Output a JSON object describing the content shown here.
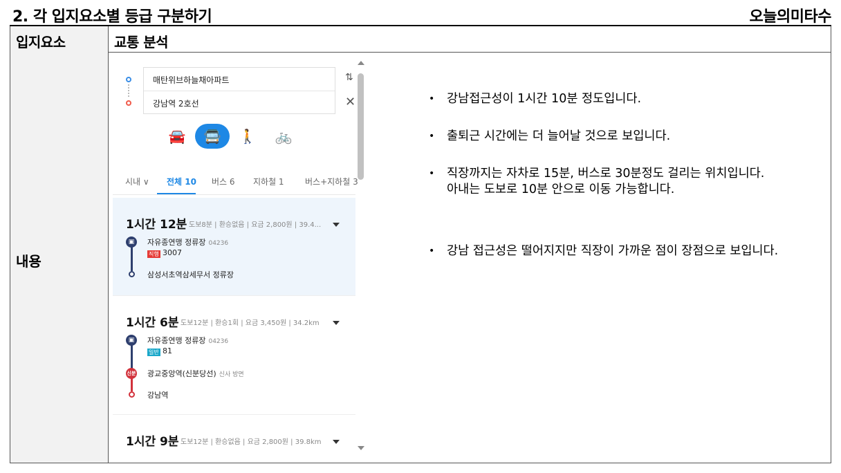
{
  "header": {
    "title": "2. 각 입지요소별 등급 구분하기",
    "brand": "오늘의미타수"
  },
  "table": {
    "label_1": "입지요소",
    "heading": "교통 분석",
    "label_2": "내용"
  },
  "app": {
    "origin": "매탄위브하늘채아파트",
    "destination": "강남역 2호선",
    "swap_icon": "⇅",
    "close_icon": "✕",
    "modes": [
      {
        "name": "car",
        "glyph": "🚘"
      },
      {
        "name": "transit",
        "glyph": "🚍"
      },
      {
        "name": "walk",
        "glyph": "🚶"
      },
      {
        "name": "bike",
        "glyph": "🚲"
      }
    ],
    "tabs": [
      "시내 ∨",
      "전체 10",
      "버스 6",
      "지하철 1",
      "버스+지하철 3"
    ],
    "routes": [
      {
        "time": "1시간 12분",
        "meta": "도보8분 | 환승없음 | 요금 2,800원 | 39.4...",
        "stop1": "자유종연맹 정류장",
        "stop1_code": "04236",
        "badge": "직행",
        "bus": "3007",
        "end": "삼성서초역삼세무서 정류장"
      },
      {
        "time": "1시간 6분",
        "meta": "도보12분 | 환승1회 | 요금 3,450원 | 34.2km",
        "stop1": "자유종연맹 정류장",
        "stop1_code": "04236",
        "badge": "일반",
        "bus": "81",
        "transfer_badge": "신분",
        "transfer": "광교중앙역(신분당선)",
        "transfer_dir": "신사 방면",
        "end": "강남역"
      },
      {
        "time": "1시간 9분",
        "meta": "도보12분 | 환승없음 | 요금 2,800원 | 39.8km"
      }
    ]
  },
  "bullets": [
    "강남접근성이 1시간 10분 정도입니다.",
    "출퇴근 시간에는 더 늘어날 것으로 보입니다.",
    "직장까지는 자차로 15분, 버스로 30분정도 걸리는 위치입니다. 아내는 도보로 10분 안으로 이동 가능합니다.",
    "강남 접근성은 떨어지지만 직장이 가까운 점이 장점으로 보입니다."
  ],
  "bullet_mark": "•",
  "colors": {
    "accent": "#1e88e5",
    "label_bg": "#f2f2f2",
    "selected_bg": "#eef5fc",
    "bus": "#2e3f6e",
    "subway": "#d2323c"
  }
}
